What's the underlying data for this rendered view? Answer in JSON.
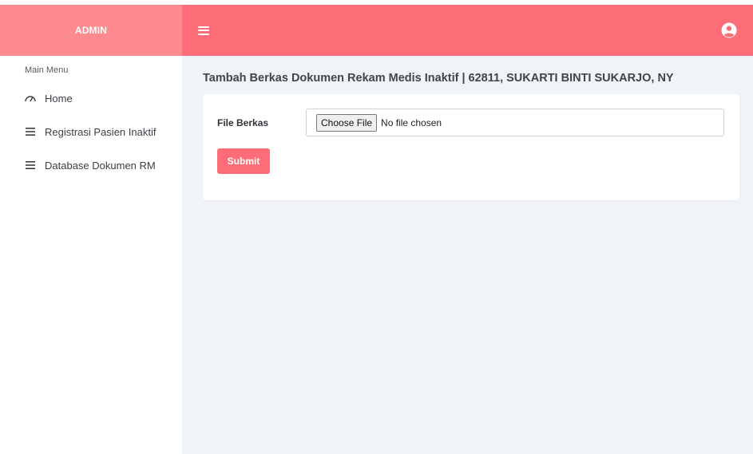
{
  "brand": {
    "title": "ADMIN"
  },
  "sidebar": {
    "heading": "Main Menu",
    "items": [
      {
        "label": "Home",
        "icon": "dashboard-icon"
      },
      {
        "label": "Registrasi Pasien Inaktif",
        "icon": "list-icon"
      },
      {
        "label": "Database Dokumen RM",
        "icon": "list-icon"
      }
    ]
  },
  "header": {
    "menu_icon": "hamburger-icon",
    "user_icon": "user-circle-icon"
  },
  "main": {
    "title": "Tambah Berkas Dokumen Rekam Medis Inaktif | 62811, SUKARTI BINTI SUKARJO, NY",
    "form": {
      "file_label": "File Berkas",
      "choose_file_label": "Choose File",
      "file_status": "No file chosen",
      "submit_label": "Submit"
    }
  },
  "colors": {
    "brand_bg": "#fc8a8f",
    "header_bg": "#fd6d78",
    "accent": "#fd6d78",
    "content_bg": "#f0f3f7"
  }
}
